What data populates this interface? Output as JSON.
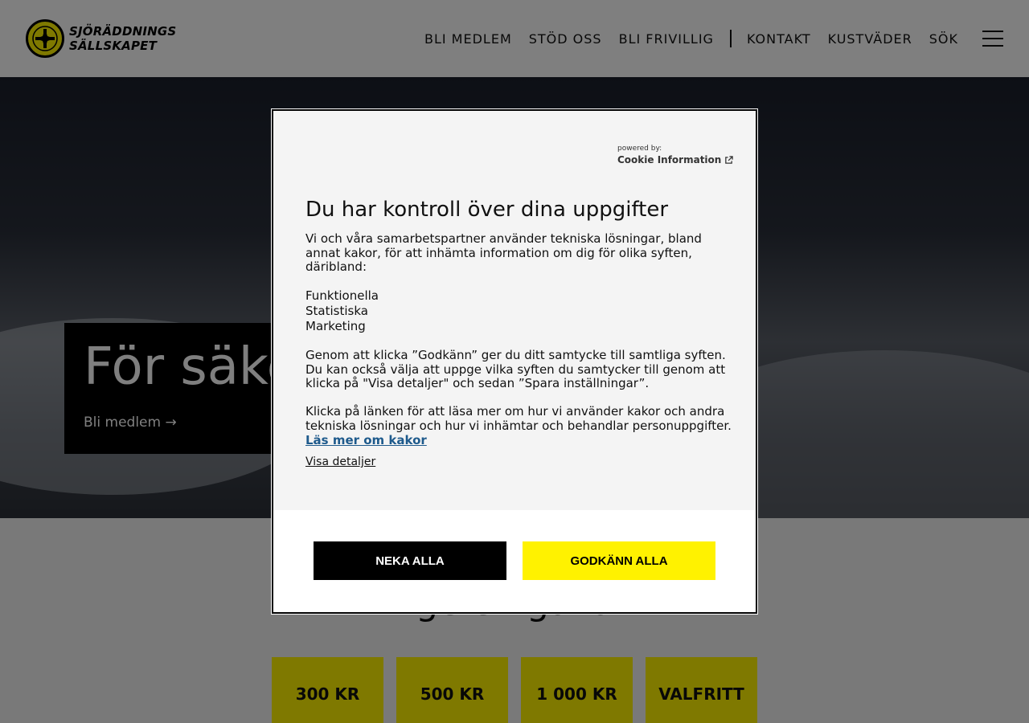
{
  "header": {
    "logo_line1": "SJÖRÄDDNINGS",
    "logo_line2": "SÄLLSKAPET",
    "nav": {
      "member": "BLI MEDLEM",
      "support": "STÖD OSS",
      "volunteer": "BLI FRIVILLIG",
      "contact": "KONTAKT",
      "weather": "KUSTVÄDER",
      "search": "SÖK"
    }
  },
  "hero": {
    "title": "För säke",
    "link": "Bli medlem →"
  },
  "gift": {
    "title": "ge en gåva",
    "amounts": [
      "300 KR",
      "500 KR",
      "1 000 KR",
      "VALFRITT"
    ]
  },
  "cookie": {
    "powered_by": "powered by:",
    "brand": "Cookie Information",
    "title": "Du har kontroll över dina uppgifter",
    "p1": "Vi och våra samarbetspartner använder tekniska lösningar, bland annat kakor, för att inhämta information om dig för olika syften, däribland:",
    "purposes": [
      "Funktionella",
      "Statistiska",
      "Marketing"
    ],
    "p2": "Genom att klicka ”Godkänn” ger du ditt samtycke till samtliga syften. Du kan också välja att uppge vilka syften du samtycker till genom att klicka på \"Visa detaljer\" och sedan ”Spara inställningar”.",
    "p3": "Klicka på länken för att läsa mer om hur vi använder kakor och andra tekniska lösningar och hur vi inhämtar och behandlar personuppgifter.",
    "read_more": "Läs mer om kakor",
    "details": "Visa detaljer",
    "deny": "NEKA ALLA",
    "accept": "GODKÄNN ALLA"
  },
  "colors": {
    "brand_yellow": "#fff200",
    "link_blue": "#1e5a8c"
  }
}
